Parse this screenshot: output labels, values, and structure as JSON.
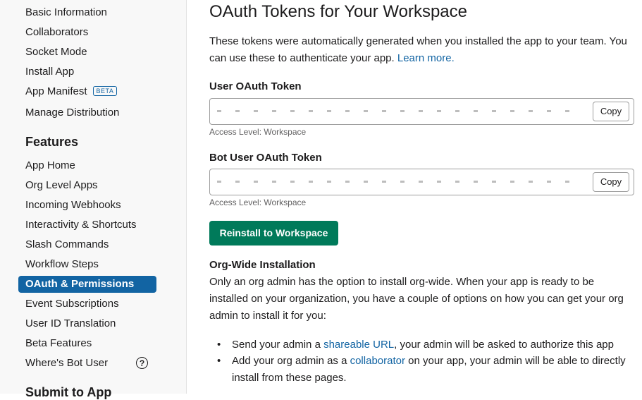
{
  "sidebar": {
    "items": [
      {
        "label": "Basic Information"
      },
      {
        "label": "Collaborators"
      },
      {
        "label": "Socket Mode"
      },
      {
        "label": "Install App"
      },
      {
        "label": "App Manifest",
        "badge": "BETA"
      },
      {
        "label": "Manage Distribution"
      }
    ],
    "features_heading": "Features",
    "features": [
      {
        "label": "App Home"
      },
      {
        "label": "Org Level Apps"
      },
      {
        "label": "Incoming Webhooks"
      },
      {
        "label": "Interactivity & Shortcuts"
      },
      {
        "label": "Slash Commands"
      },
      {
        "label": "Workflow Steps"
      },
      {
        "label": "OAuth & Permissions",
        "active": true
      },
      {
        "label": "Event Subscriptions"
      },
      {
        "label": "User ID Translation"
      },
      {
        "label": "Beta Features"
      },
      {
        "label": "Where's Bot User",
        "help_icon": "question-circle-icon"
      }
    ],
    "submit_heading": "Submit to App"
  },
  "main": {
    "title": "OAuth Tokens for Your Workspace",
    "intro_text": "These tokens were automatically generated when you installed the app to your team. You can use these to authenticate your app.",
    "intro_link": "Learn more.",
    "user_token": {
      "label": "User OAuth Token",
      "copy": "Copy",
      "access": "Access Level: Workspace"
    },
    "bot_token": {
      "label": "Bot User OAuth Token",
      "copy": "Copy",
      "access": "Access Level: Workspace"
    },
    "reinstall_button": "Reinstall to Workspace",
    "org_wide": {
      "heading": "Org-Wide Installation",
      "body": "Only an org admin has the option to install org-wide. When your app is ready to be installed on your organization, you have a couple of options on how you can get your org admin to install it for you:",
      "bullet1_pre": "Send your admin a ",
      "bullet1_link": "shareable URL",
      "bullet1_post": ", your admin will be asked to authorize this app",
      "bullet2_pre": "Add your org admin as a ",
      "bullet2_link": "collaborator",
      "bullet2_post": " on your app, your admin will be able to directly install from these pages."
    }
  },
  "colors": {
    "accent": "#1264a3",
    "primary_button": "#007a5a",
    "sidebar_bg": "#f8f8f8"
  }
}
